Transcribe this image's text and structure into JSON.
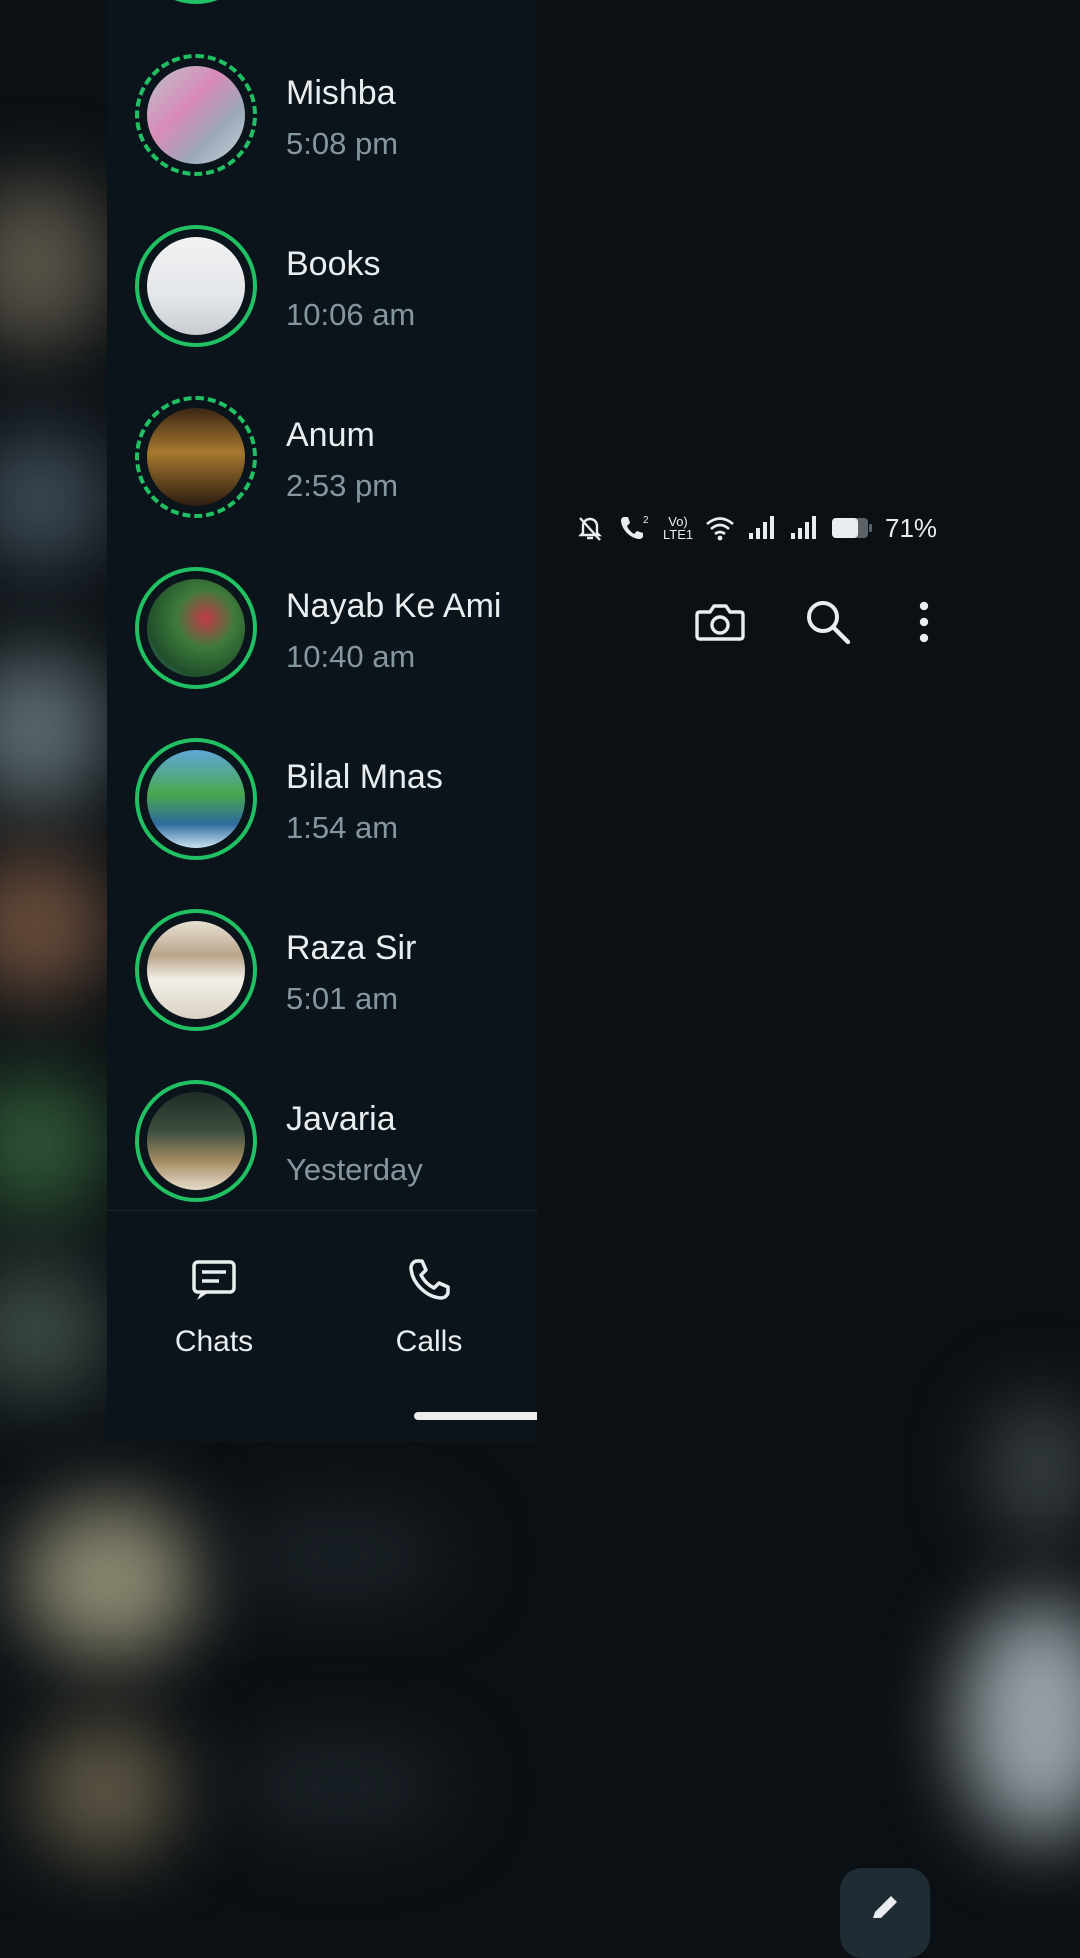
{
  "chats": [
    {
      "name": "Mishba",
      "time": "5:08 pm"
    },
    {
      "name": "Books",
      "time": "10:06 am"
    },
    {
      "name": "Anum",
      "time": "2:53 pm"
    },
    {
      "name": "Nayab Ke Ami",
      "time": "10:40 am"
    },
    {
      "name": "Bilal Mnas",
      "time": "1:54 am"
    },
    {
      "name": "Raza Sir",
      "time": "5:01 am"
    },
    {
      "name": "Javaria",
      "time": "Yesterday"
    }
  ],
  "nav": {
    "chats_label": "Chats",
    "calls_label": "Calls"
  },
  "status": {
    "battery": "71%",
    "network_label": "Vo) LTE1"
  },
  "icons": {
    "camera": "camera-icon",
    "search": "search-icon",
    "menu": "more-vert-icon",
    "edit": "pencil-icon"
  },
  "colors": {
    "background": "#0b141a",
    "ring": "#21c063",
    "secondary_text": "#8696a0"
  }
}
